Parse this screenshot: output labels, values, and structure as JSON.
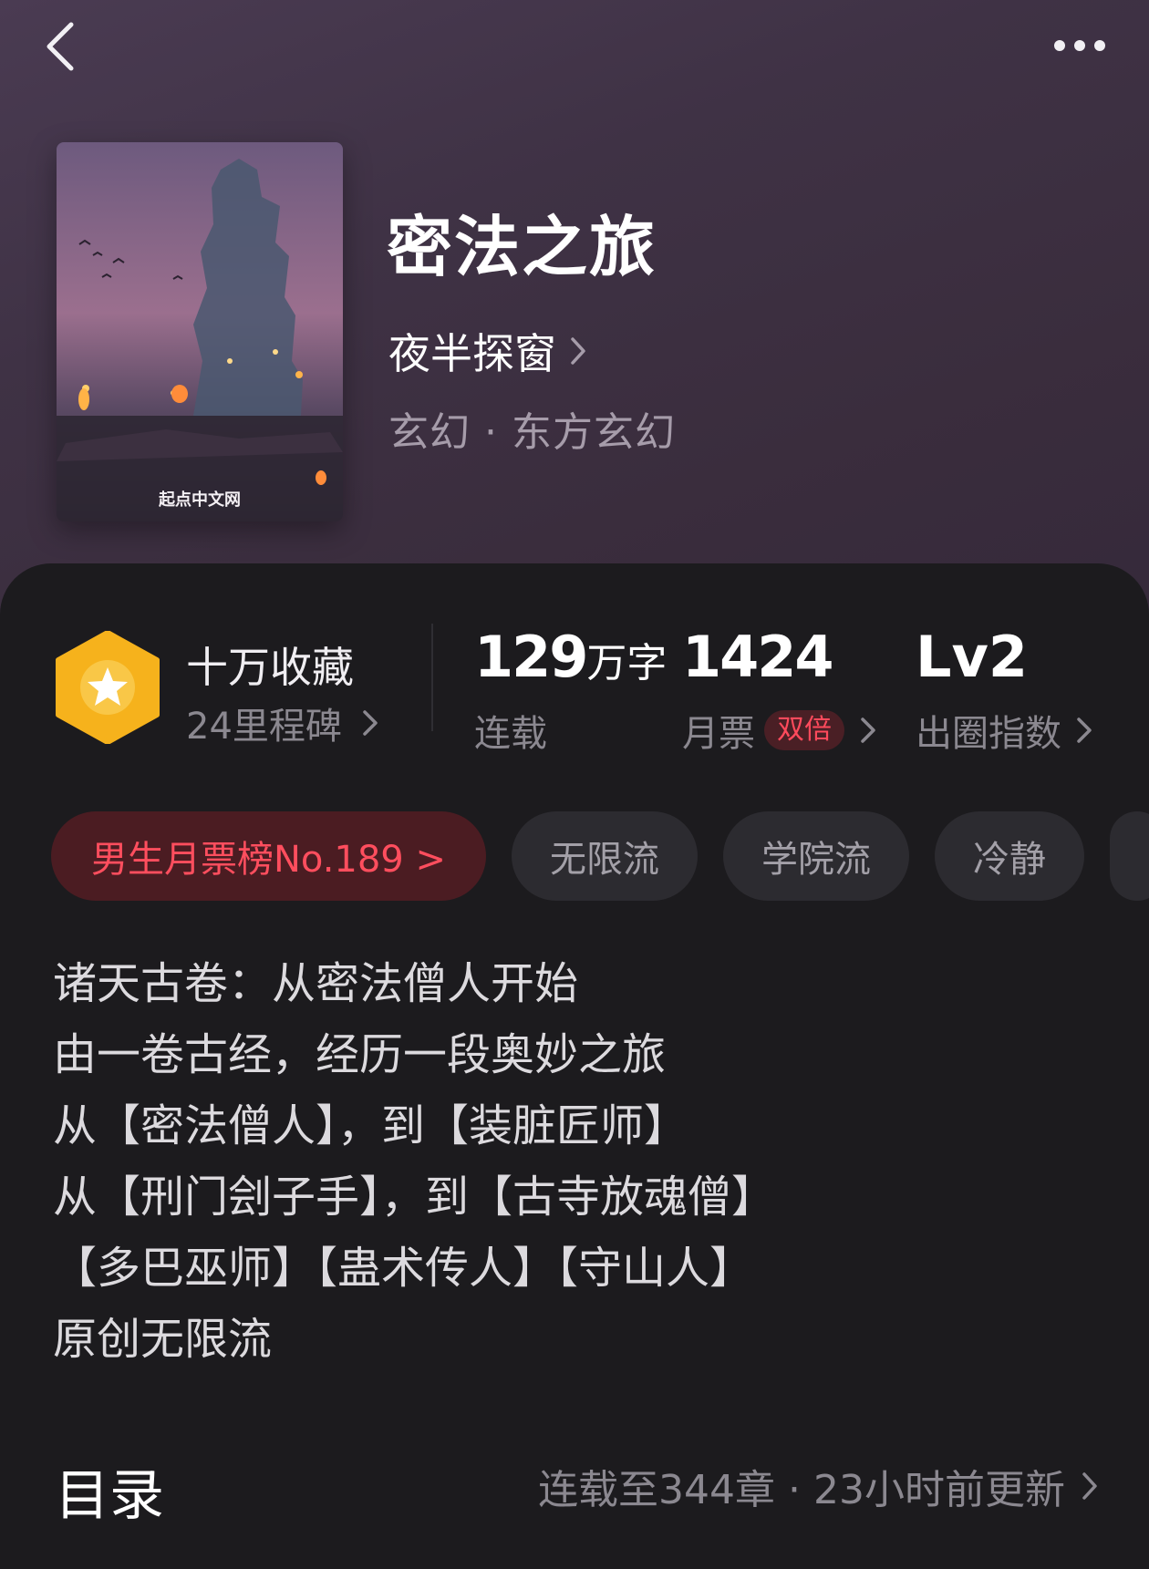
{
  "nav": {
    "back_icon": "chevron-left-icon",
    "more_icon": "more-dots-icon"
  },
  "book": {
    "cover_publisher": "起点中文网",
    "title": "密法之旅",
    "author": "夜半探窗",
    "genre": "玄幻 · 东方玄幻"
  },
  "stats": {
    "collection": {
      "title": "十万收藏",
      "subtitle": "24里程碑"
    },
    "words": {
      "value": "129",
      "unit": "万字",
      "label": "连载"
    },
    "monthly_votes": {
      "value": "1424",
      "label": "月票",
      "badge": "双倍"
    },
    "influence": {
      "value": "Lv2",
      "label": "出圈指数"
    }
  },
  "tags": [
    "男生月票榜No.189 >",
    "无限流",
    "学院流",
    "冷静"
  ],
  "description": [
    "诸天古卷：从密法僧人开始",
    "由一卷古经，经历一段奥妙之旅",
    "从【密法僧人】，到【装脏匠师】",
    "从【刑门刽子手】，到【古寺放魂僧】",
    "【多巴巫师】【蛊术传人】【守山人】",
    "原创无限流"
  ],
  "toc": {
    "title": "目录",
    "status": "连载至344章 · 23小时前更新"
  },
  "colors": {
    "accent_red": "#ff4e5e",
    "badge_gold": "#f7b21a",
    "panel_bg": "#1c1b1e"
  }
}
